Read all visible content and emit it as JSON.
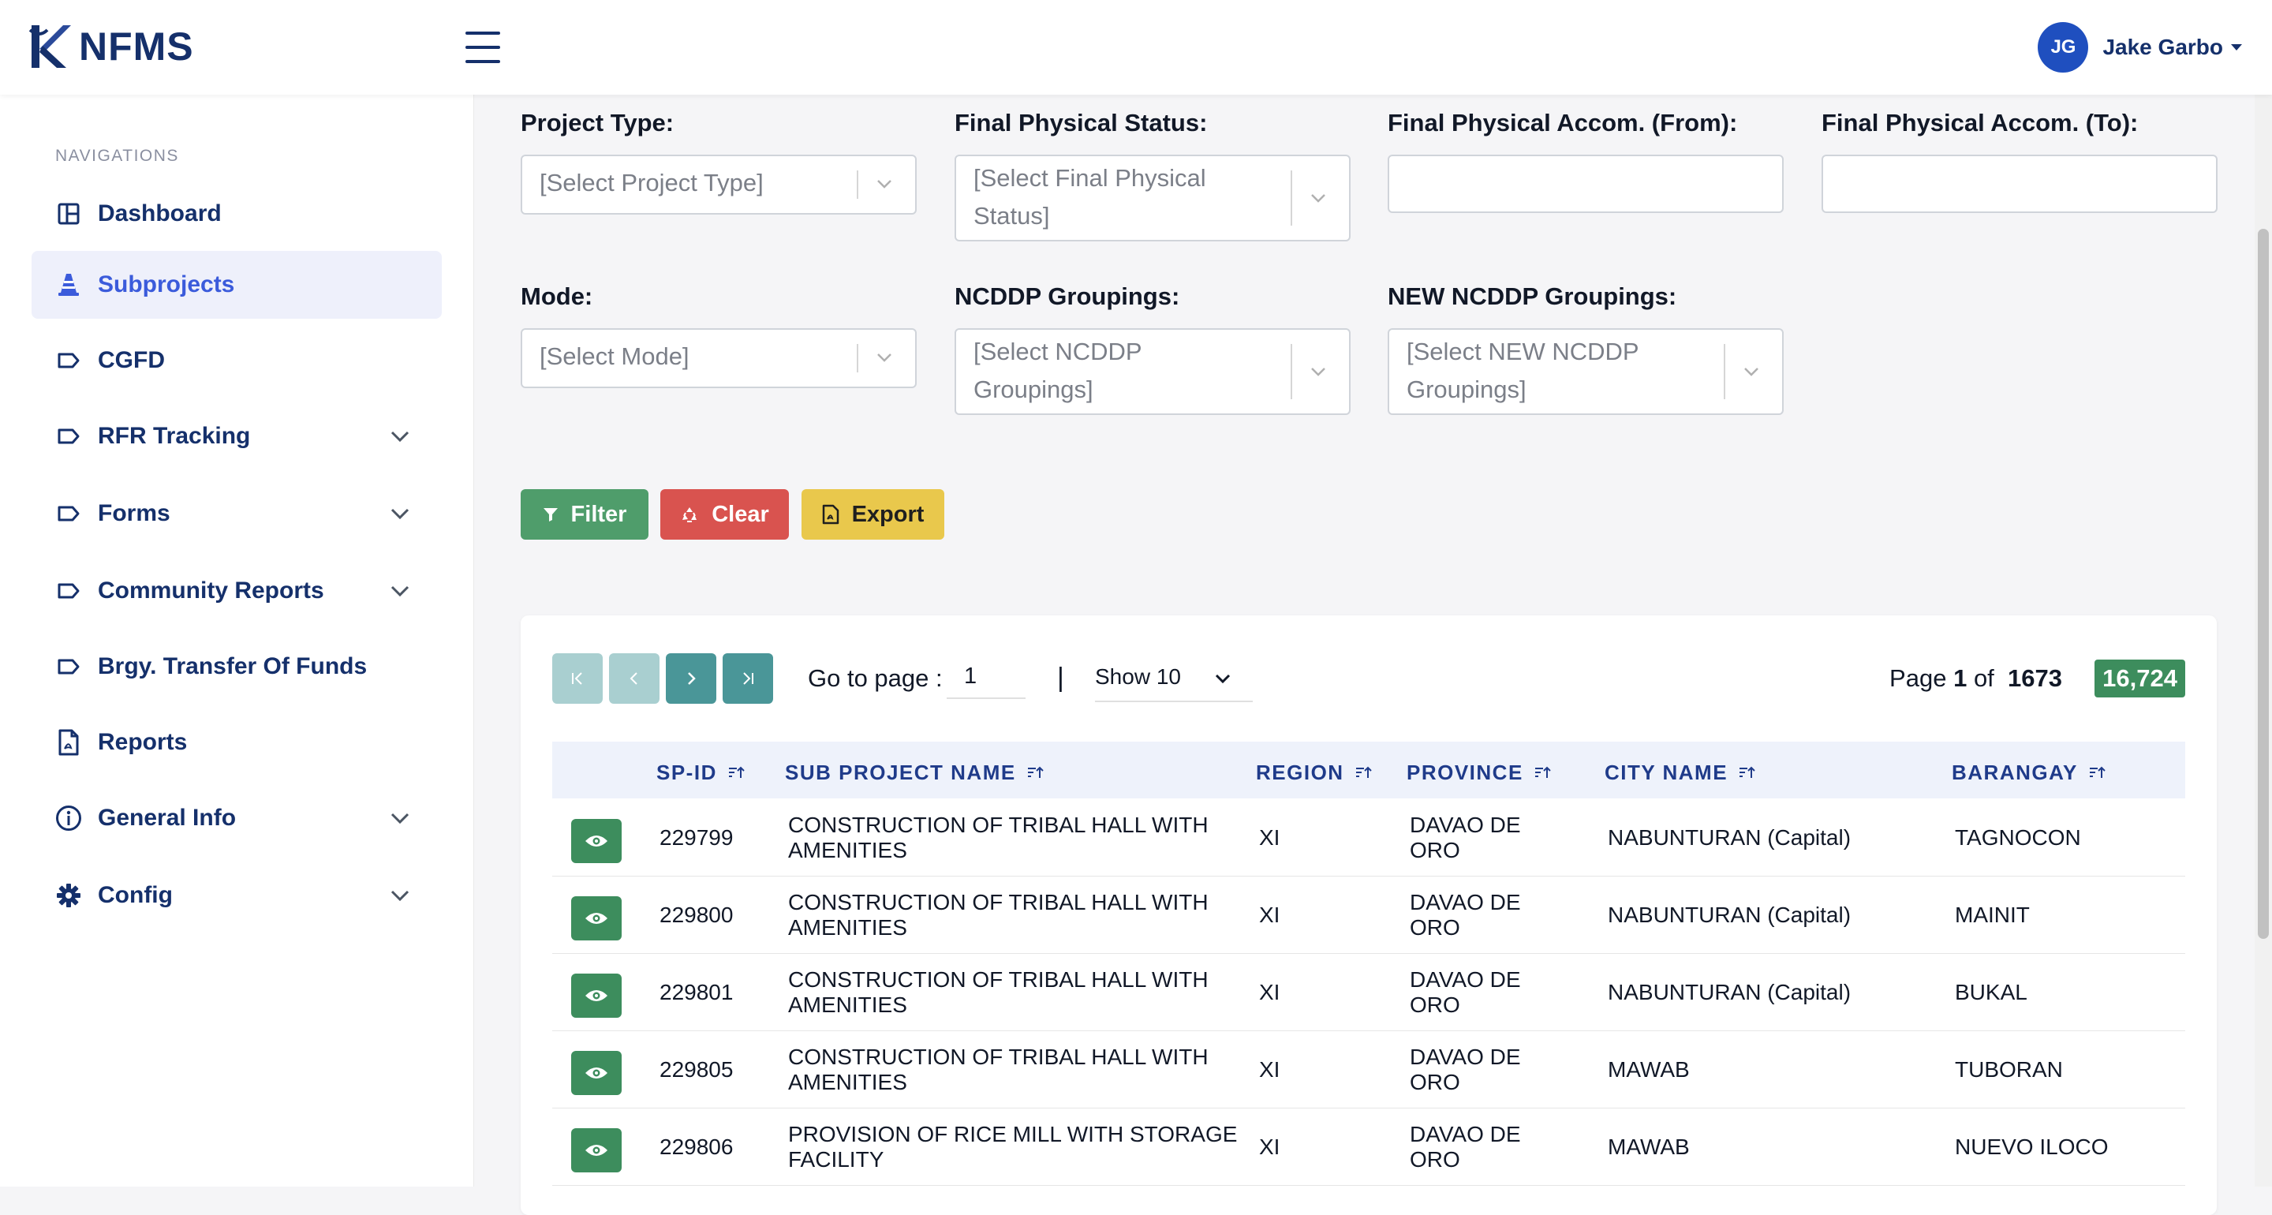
{
  "app": {
    "logo_text": "NFMS",
    "logo_icon": "k-logo-icon"
  },
  "user": {
    "initials": "JG",
    "name": "Jake Garbo"
  },
  "sidebar": {
    "heading": "NAVIGATIONS",
    "items": [
      {
        "label": "Dashboard",
        "icon": "dashboard-icon"
      },
      {
        "label": "Subprojects",
        "icon": "traffic-cone-icon",
        "active": true
      },
      {
        "label": "CGFD",
        "icon": "tag-icon"
      },
      {
        "label": "RFR Tracking",
        "icon": "tag-icon",
        "expandable": true
      },
      {
        "label": "Forms",
        "icon": "tag-icon",
        "expandable": true
      },
      {
        "label": "Community Reports",
        "icon": "tag-icon",
        "expandable": true
      },
      {
        "label": "Brgy. Transfer Of Funds",
        "icon": "tag-icon"
      },
      {
        "label": "Reports",
        "icon": "pdf-file-icon"
      },
      {
        "label": "General Info",
        "icon": "info-icon",
        "expandable": true
      },
      {
        "label": "Config",
        "icon": "gear-icon",
        "expandable": true
      }
    ]
  },
  "filters": {
    "project_type": {
      "label": "Project Type:",
      "placeholder": "[Select Project Type]"
    },
    "final_physical_status": {
      "label": "Final Physical Status:",
      "placeholder_line1": "[Select Final Physical",
      "placeholder_line2": "Status]"
    },
    "accom_from": {
      "label": "Final Physical Accom. (From):",
      "value": ""
    },
    "accom_to": {
      "label": "Final Physical Accom. (To):",
      "value": ""
    },
    "mode": {
      "label": "Mode:",
      "placeholder": "[Select Mode]"
    },
    "ncddp": {
      "label": "NCDDP Groupings:",
      "placeholder_line1": "[Select NCDDP",
      "placeholder_line2": "Groupings]"
    },
    "new_ncddp": {
      "label": "NEW NCDDP Groupings:",
      "placeholder_line1": "[Select NEW NCDDP",
      "placeholder_line2": "Groupings]"
    }
  },
  "actions": {
    "filter": "Filter",
    "clear": "Clear",
    "export": "Export"
  },
  "colors": {
    "primary": "#15306b",
    "accent": "#3b5bdb",
    "filter": "#4f9d6b",
    "clear": "#d9534f",
    "export": "#e9c84c",
    "success": "#3d8d5d",
    "pager_disabled": "#a9cfd0",
    "pager_active": "#4a9698"
  },
  "pagination": {
    "goto_label": "Go to page :",
    "goto_value": "1",
    "separator": "|",
    "show_label": "Show 10",
    "page_prefix": "Page",
    "page_current": "1",
    "page_of": "of",
    "page_total": "1673",
    "total_count": "16,724"
  },
  "table": {
    "columns": [
      "SP-ID",
      "SUB PROJECT NAME",
      "REGION",
      "PROVINCE",
      "CITY NAME",
      "BARANGAY"
    ],
    "rows": [
      {
        "spid": "229799",
        "name1": "CONSTRUCTION OF TRIBAL HALL WITH",
        "name2": "AMENITIES",
        "region": "XI",
        "prov1": "DAVAO DE",
        "prov2": "ORO",
        "city": "NABUNTURAN (Capital)",
        "barangay": "TAGNOCON"
      },
      {
        "spid": "229800",
        "name1": "CONSTRUCTION OF TRIBAL HALL WITH",
        "name2": "AMENITIES",
        "region": "XI",
        "prov1": "DAVAO DE",
        "prov2": "ORO",
        "city": "NABUNTURAN (Capital)",
        "barangay": "MAINIT"
      },
      {
        "spid": "229801",
        "name1": "CONSTRUCTION OF TRIBAL HALL WITH",
        "name2": "AMENITIES",
        "region": "XI",
        "prov1": "DAVAO DE",
        "prov2": "ORO",
        "city": "NABUNTURAN (Capital)",
        "barangay": "BUKAL"
      },
      {
        "spid": "229805",
        "name1": "CONSTRUCTION OF TRIBAL HALL WITH",
        "name2": "AMENITIES",
        "region": "XI",
        "prov1": "DAVAO DE",
        "prov2": "ORO",
        "city": "MAWAB",
        "barangay": "TUBORAN"
      },
      {
        "spid": "229806",
        "name1": "PROVISION OF RICE MILL WITH STORAGE",
        "name2": "FACILITY",
        "region": "XI",
        "prov1": "DAVAO DE",
        "prov2": "ORO",
        "city": "MAWAB",
        "barangay": "NUEVO ILOCO"
      }
    ]
  }
}
